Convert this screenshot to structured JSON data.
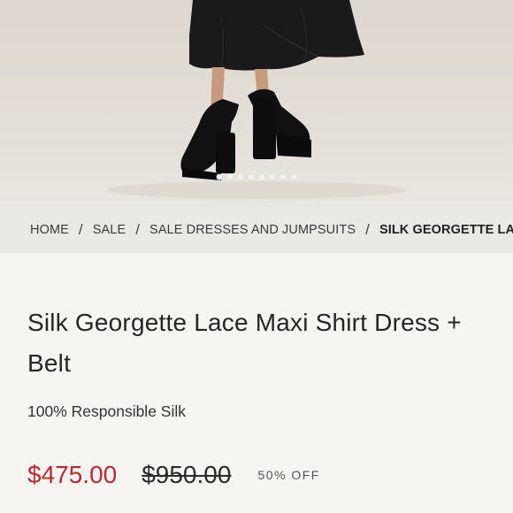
{
  "gallery": {
    "image_alt": "Model wearing black maxi dress with black platform slingback heels",
    "dot_count": 8,
    "active_dot": 0
  },
  "breadcrumb": {
    "items": [
      "HOME",
      "SALE",
      "SALE DRESSES AND JUMPSUITS",
      "SILK GEORGETTE LACE MAXI SHIRT DRESS + BELT"
    ],
    "separator": "/"
  },
  "product": {
    "title": "Silk Georgette Lace Maxi Shirt Dress + Belt",
    "subtitle": "100% Responsible Silk",
    "sale_price": "$475.00",
    "original_price": "$950.00",
    "discount": "50% OFF"
  },
  "colors": {
    "sale_price": "#c0282d",
    "breadcrumb_bg": "#ebe9e5",
    "page_bg": "#f6f5f2"
  }
}
